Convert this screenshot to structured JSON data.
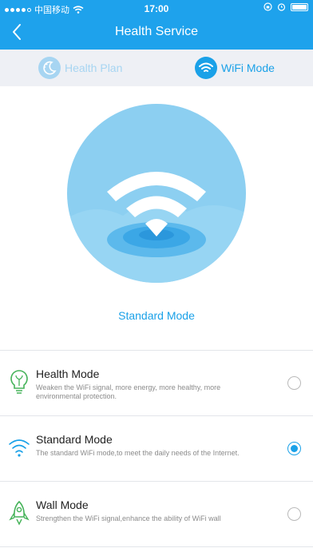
{
  "status_bar": {
    "carrier": "中国移动",
    "time": "17:00"
  },
  "navbar": {
    "title": "Health Service",
    "back_icon": "chevron-left-icon"
  },
  "tabs": [
    {
      "label": "Health Plan",
      "icon": "moon-icon",
      "selected": false
    },
    {
      "label": "WiFi Mode",
      "icon": "wifi-icon",
      "selected": true
    }
  ],
  "current_mode": {
    "label": "Standard Mode"
  },
  "modes": [
    {
      "title": "Health Mode",
      "description": "Weaken the WiFi signal, more energy, more healthy, more environmental protection.",
      "icon": "lightbulb-icon",
      "selected": false
    },
    {
      "title": "Standard Mode",
      "description": "The standard WiFi mode,to meet the daily needs of the Internet.",
      "icon": "wifi-icon",
      "selected": true
    },
    {
      "title": "Wall Mode",
      "description": "Strengthen the WiFi signal,enhance the ability of WiFi wall",
      "icon": "rocket-icon",
      "selected": false
    }
  ],
  "colors": {
    "accent": "#1ea2ec",
    "tab_bg": "#eef0f5",
    "hero_circle": "#8ccff1"
  }
}
